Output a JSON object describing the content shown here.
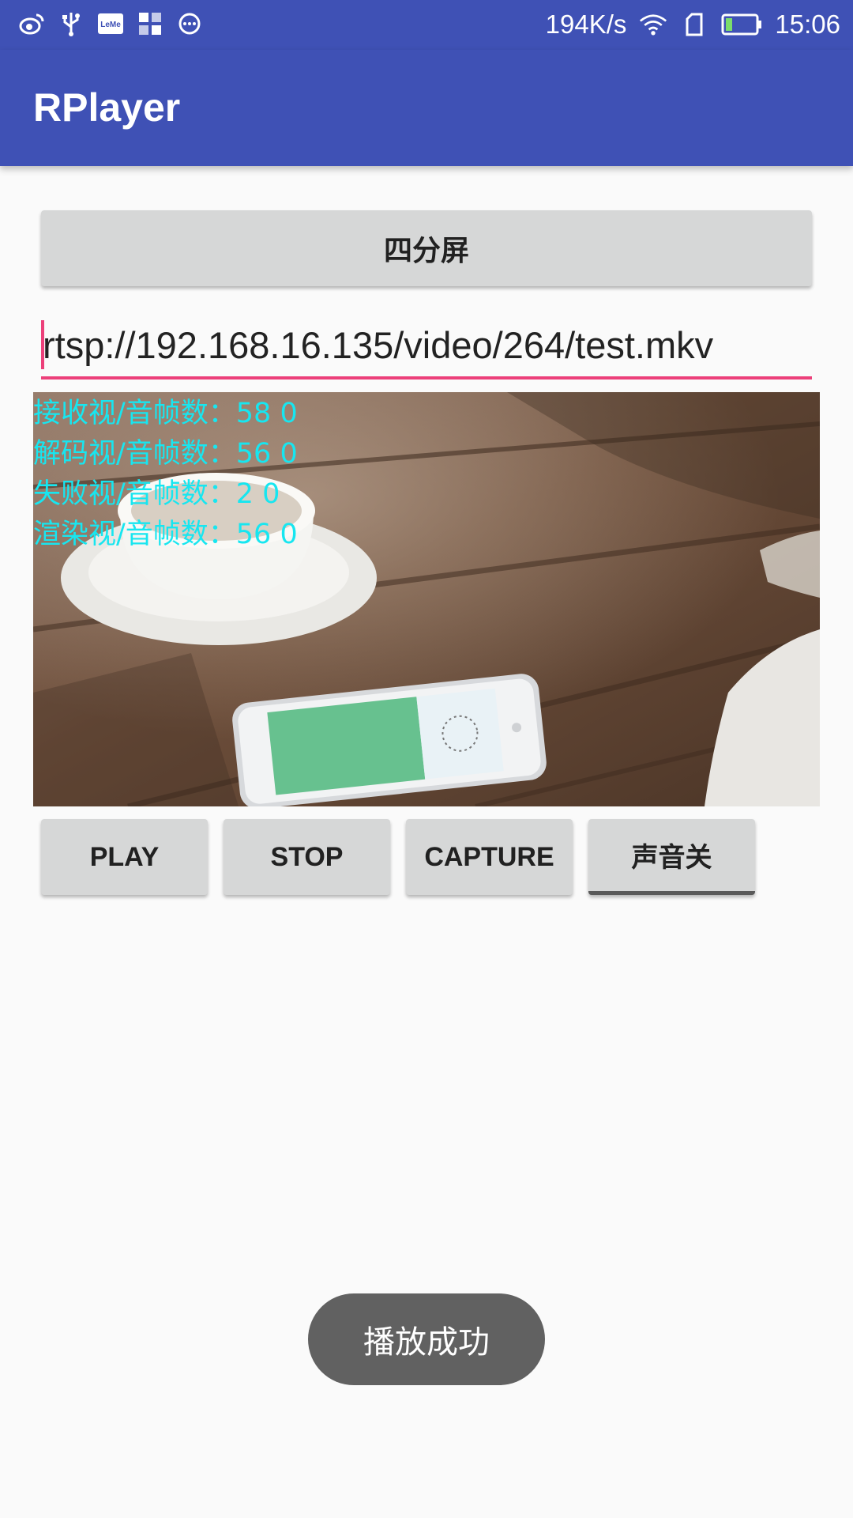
{
  "status_bar": {
    "left_icons": [
      "weibo-icon",
      "usb-icon",
      "leme-icon",
      "apps-icon",
      "message-icon"
    ],
    "leme_text": "LeMe",
    "net_speed": "194K/s",
    "time": "15:06",
    "right_icons": [
      "wifi-icon",
      "sim-icon",
      "battery-icon"
    ]
  },
  "app_bar": {
    "title": "RPlayer"
  },
  "quad_button": {
    "label": "四分屏"
  },
  "url_input": {
    "value": "rtsp://192.168.16.135/video/264/test.mkv"
  },
  "video_stats": {
    "received": "接收视/音帧数：58 0",
    "decoded": "解码视/音帧数：56 0",
    "failed": "失败视/音帧数：2 0",
    "rendered": "渲染视/音帧数：56 0"
  },
  "controls": {
    "play": "PLAY",
    "stop": "STOP",
    "capture": "CAPTURE",
    "audio_toggle": "声音关"
  },
  "toast": {
    "message": "播放成功"
  },
  "colors": {
    "primary": "#3f51b5",
    "accent": "#ec407a",
    "stats_text": "#17e6f0",
    "button_bg": "#d6d7d7",
    "toast_bg": "#616161"
  }
}
